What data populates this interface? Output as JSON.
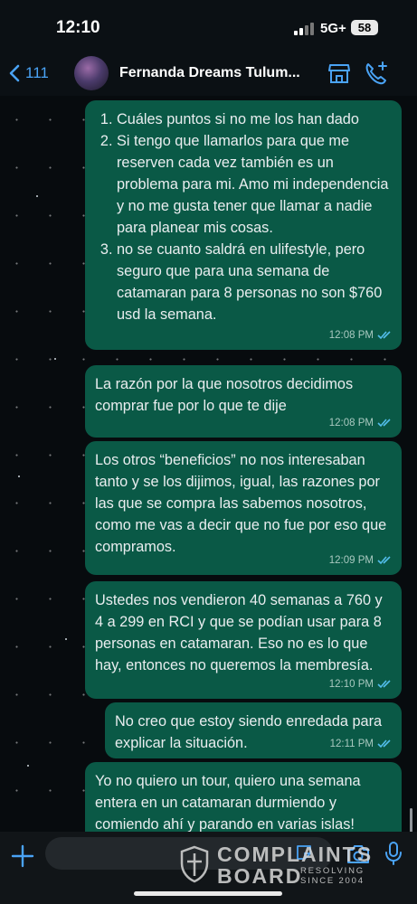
{
  "status_bar": {
    "time": "12:10",
    "network": "5G+",
    "battery": "58"
  },
  "header": {
    "back_count": "111",
    "contact_name": "Fernanda Dreams Tulum...",
    "icons": [
      "back-chevron-icon",
      "avatar",
      "shop-icon",
      "call-add-icon"
    ],
    "accent_color": "#4aa3f5"
  },
  "messages": [
    {
      "type": "list",
      "items": [
        "Cuáles puntos si no me los han dado",
        "Si tengo que llamarlos para que me reserven cada vez también es un problema para mi. Amo mi independencia y no me gusta tener que llamar a nadie para planear mis cosas.",
        "no se cuanto saldrá en ulifestyle, pero seguro que para una semana de catamaran para 8 personas no son $760 usd la semana."
      ],
      "time": "12:08 PM"
    },
    {
      "type": "text",
      "text": "La razón por la que nosotros decidimos comprar fue por lo que te dije",
      "time": "12:08 PM"
    },
    {
      "type": "text",
      "text": "Los otros “beneficios” no nos interesaban tanto y se los dijimos, igual, las razones por las que se compra las sabemos nosotros, como me vas a decir que no fue por eso que compramos.",
      "time": "12:09 PM"
    },
    {
      "type": "text",
      "text": "Ustedes nos vendieron 40 semanas a 760 y 4 a 299 en RCI y que se podían usar para 8 personas en catamaran. Eso no es lo que hay, entonces no queremos la membresía.",
      "time": "12:10 PM"
    },
    {
      "type": "text",
      "text": "No creo que estoy siendo enredada para explicar la situación.",
      "time": "12:11 PM"
    },
    {
      "type": "text",
      "text": "Yo no quiero un tour, quiero una semana entera en un catamaran durmiendo y comiendo ahí y parando en varias islas!",
      "time": ""
    }
  ],
  "colors": {
    "bubble": "#0a5946",
    "read_ticks": "#53bdeb",
    "background": "#0b1014"
  },
  "composer": {
    "icons": [
      "plus-icon",
      "sticker-icon",
      "camera-icon",
      "mic-icon"
    ]
  },
  "watermark": {
    "line1": "COMPLAINTS",
    "line2": "BOARD",
    "tag1": "RESOLVING",
    "tag2": "SINCE 2004"
  }
}
